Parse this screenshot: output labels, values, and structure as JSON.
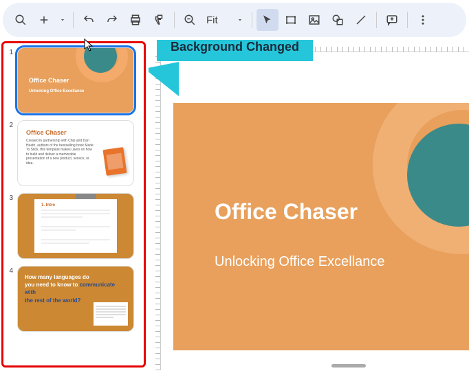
{
  "toolbar": {
    "zoom_label": "Fit"
  },
  "callout": {
    "text": "Background Changed"
  },
  "slide": {
    "title": "Office Chaser",
    "subtitle": "Unlocking Office Excellance"
  },
  "thumbs": [
    {
      "num": "1",
      "title": "Office Chaser",
      "subtitle": "Unlocking Office Excellance"
    },
    {
      "num": "2",
      "title": "Office Chaser",
      "body": "Created in partnership with Chip and Dan Heath, authors of the bestselling book Made To Stick, this template makes users on how to build and deliver a memorable presentation of a new product, service, or idea."
    },
    {
      "num": "3",
      "heading": "1. Intro"
    },
    {
      "num": "4",
      "line1a": "How many languages do",
      "line1b": "you need to know to ",
      "line1c": "communicate",
      "line2a": "with",
      "line3": "the rest of the world?"
    }
  ]
}
